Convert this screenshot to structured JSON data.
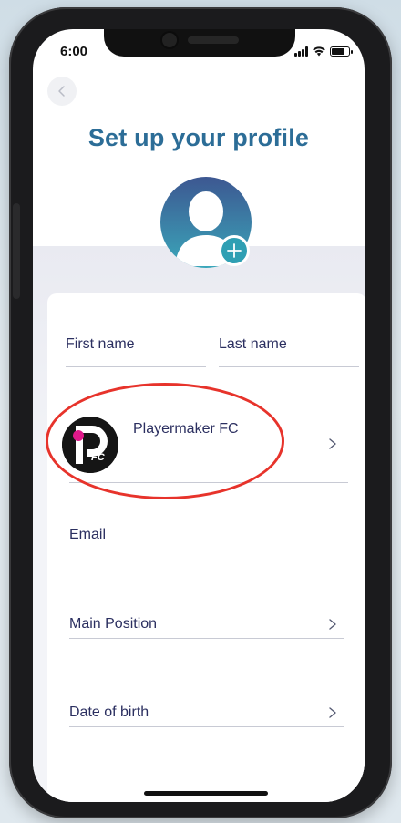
{
  "status_bar": {
    "time": "6:00"
  },
  "header": {
    "back_icon": "chevron-left-icon",
    "title": "Set up your profile"
  },
  "avatar": {
    "placeholder_icon": "person-silhouette-icon",
    "add_icon": "plus-icon"
  },
  "form": {
    "first_name_label": "First name",
    "last_name_label": "Last name",
    "club": {
      "name": "Playermaker FC",
      "logo_text": "FC"
    },
    "email_label": "Email",
    "main_position_label": "Main Position",
    "date_of_birth_label": "Date of birth"
  },
  "colors": {
    "title": "#2c6d97",
    "label": "#2b2f60",
    "avatar_top": "#3d5791",
    "avatar_bottom": "#3aa7ba",
    "highlight": "#e7332b",
    "logo_dot": "#e0198a"
  }
}
